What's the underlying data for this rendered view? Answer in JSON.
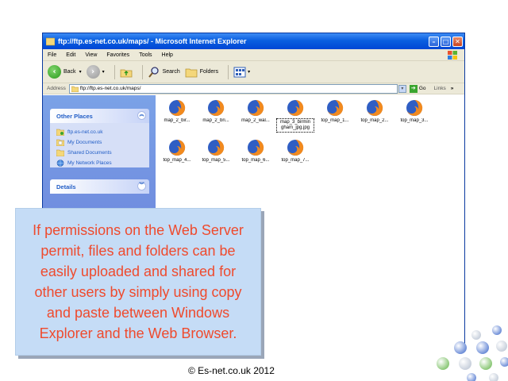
{
  "window": {
    "title": "ftp://ftp.es-net.co.uk/maps/ - Microsoft Internet Explorer",
    "buttons": {
      "minimize": "–",
      "maximize": "□",
      "close": "✕"
    }
  },
  "menu": [
    "File",
    "Edit",
    "View",
    "Favorites",
    "Tools",
    "Help"
  ],
  "toolbar": {
    "back": "Back",
    "search": "Search",
    "folders": "Folders"
  },
  "address": {
    "label": "Address",
    "value": "ftp://ftp.es-net.co.uk/maps/",
    "go": "Go",
    "links": "Links"
  },
  "left_pane": {
    "other_places": {
      "title": "Other Places",
      "items": [
        "ftp.es-net.co.uk",
        "My Documents",
        "Shared Documents",
        "My Network Places"
      ]
    },
    "details": {
      "title": "Details"
    }
  },
  "files": [
    "map_2_bir...",
    "map_2_bri...",
    "map_2_wal...",
    "map_3_birmingham_jpg.jpg",
    "top_map_1...",
    "top_map_2...",
    "top_map_3...",
    "top_map_4...",
    "top_map_5...",
    "top_map_6...",
    "top_map_7..."
  ],
  "selected_file": {
    "line1": "map_3_birmin",
    "line2": "gham_jpg.jpg"
  },
  "caption": "If permissions on the Web Server permit, files and folders can be easily uploaded and shared for other users by simply using copy and paste between Windows Explorer and the Web Browser.",
  "footer": "© Es-net.co.uk 2012",
  "colors": {
    "caption_text": "#ef4a2d",
    "caption_bg": "#c5dcf6",
    "titlebar": "#0a5fe0"
  }
}
